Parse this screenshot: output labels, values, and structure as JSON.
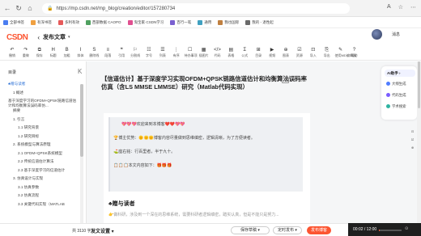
{
  "browser": {
    "url": "https://mp.csdn.net/mp_blog/creation/editor/157280734",
    "right_label": "A",
    "bookmarks": [
      "全部书签",
      "有深书签",
      "多利有效",
      "西部数据 CAOPO",
      "淘宝家·CSDN学习",
      "百行一笔",
      "通用",
      "我也国际",
      "我的 - 退性起"
    ]
  },
  "header": {
    "logo": "CSDN",
    "back": "‹",
    "title": "发布文章",
    "caret": "▾",
    "user": "消息"
  },
  "toolbar": {
    "items": [
      {
        "icon": "↶",
        "label": "撤销"
      },
      {
        "icon": "↷",
        "label": "重做"
      },
      {
        "icon": "⧉",
        "label": "保存"
      },
      {
        "icon": "H",
        "label": "标题"
      },
      {
        "icon": "B",
        "label": "加粗"
      },
      {
        "icon": "I",
        "label": "斜体"
      },
      {
        "icon": "S",
        "label": "删除线"
      },
      {
        "icon": "≡",
        "label": "段落"
      },
      {
        "icon": "❝",
        "label": "引用"
      },
      {
        "icon": "⚐",
        "label": "分割线"
      },
      {
        "icon": "☷",
        "label": "字号"
      },
      {
        "icon": "☰",
        "label": "列表"
      },
      {
        "icon": "⋮",
        "label": "有序"
      },
      {
        "icon": "☐",
        "label": "待办事项"
      },
      {
        "icon": "▦",
        "label": "插图片"
      },
      {
        "icon": "</>",
        "label": "代码"
      },
      {
        "icon": "▤",
        "label": "表格"
      },
      {
        "icon": "Σ",
        "label": "公式"
      },
      {
        "icon": "⊞",
        "label": "目录"
      },
      {
        "icon": "▶",
        "label": "视频"
      },
      {
        "icon": "⊕",
        "label": "图表"
      },
      {
        "icon": "☑",
        "label": "资源"
      },
      {
        "icon": "⊡",
        "label": "导入"
      },
      {
        "icon": "⎘",
        "label": "导出"
      },
      {
        "icon": "✎",
        "label": "使用MD编辑器"
      },
      {
        "icon": "?",
        "label": "帮助"
      }
    ]
  },
  "toc": {
    "title": "目录",
    "collapse": "K",
    "items": [
      {
        "text": "♣赠与读者",
        "indent": 0
      },
      {
        "text": "1 概述",
        "indent": 1
      },
      {
        "text": "基于深度学习的OFDM+QPSK链路信道估计和均衡算法误码率仿...",
        "indent": 0
      },
      {
        "text": "",
        "indent": 0
      },
      {
        "text": "摘要",
        "indent": 1
      },
      {
        "text": "1. 引言",
        "indent": 1
      },
      {
        "text": "1.1 研究背景",
        "indent": 2
      },
      {
        "text": "1.2 研究目标",
        "indent": 2
      },
      {
        "text": "2. 系统模型与算法原理",
        "indent": 1
      },
      {
        "text": "2.1 OFDM+QPSK系统模型",
        "indent": 2
      },
      {
        "text": "2.2 传统信道估计算法",
        "indent": 2
      },
      {
        "text": "2.3 基于深度学习的信道估计",
        "indent": 2
      },
      {
        "text": "3. 仿真设计与实现",
        "indent": 1
      },
      {
        "text": "3.1 仿真参数",
        "indent": 2
      },
      {
        "text": "3.2 仿真流程",
        "indent": 2
      },
      {
        "text": "3.3 关键代码实现（MATLAB",
        "indent": 2
      }
    ]
  },
  "document": {
    "title": "【信道估计】基于深度学习实现OFDM+QPSK链路信道估计和均衡算法误码率仿真（含LS MMSE LMMSE）研究（Matlab代码实现）",
    "title_count": "69 / 100",
    "quote_lines": [
      "💖💖💖欢迎来到本博客❤️❤️💖💖",
      "",
      "🏆博主优势：🌞🌞🌞博客内容尽量做到思维缜密，逻辑清晰，为了方便读者。",
      "",
      "⛳️座右铭：行百里者，半于九十。",
      "",
      "📋📋📋本文内容如下：🎁🎁🎁"
    ],
    "heading": "♣赠与读者",
    "para_cut": "👉做科研，涉及到一个深在的思维系统，需要科研者逻辑缜密，踏实认真，但是不能只是努力..."
  },
  "ai_panel": {
    "main": "AI助手 ›",
    "items": [
      "大纲生成",
      "代码生成",
      "学术搜索"
    ]
  },
  "side_icons": [
    "⊡",
    "☑",
    "⊕"
  ],
  "bottom": {
    "word_count": "共 3110 字",
    "settings": "发文设置 ▾",
    "draft": "保存草稿 ▾",
    "schedule": "定时发布 ▾",
    "publish": "发布博客",
    "time": "00:02 / 12:00",
    "progress": 0.03,
    "ctrl": "⊙"
  }
}
